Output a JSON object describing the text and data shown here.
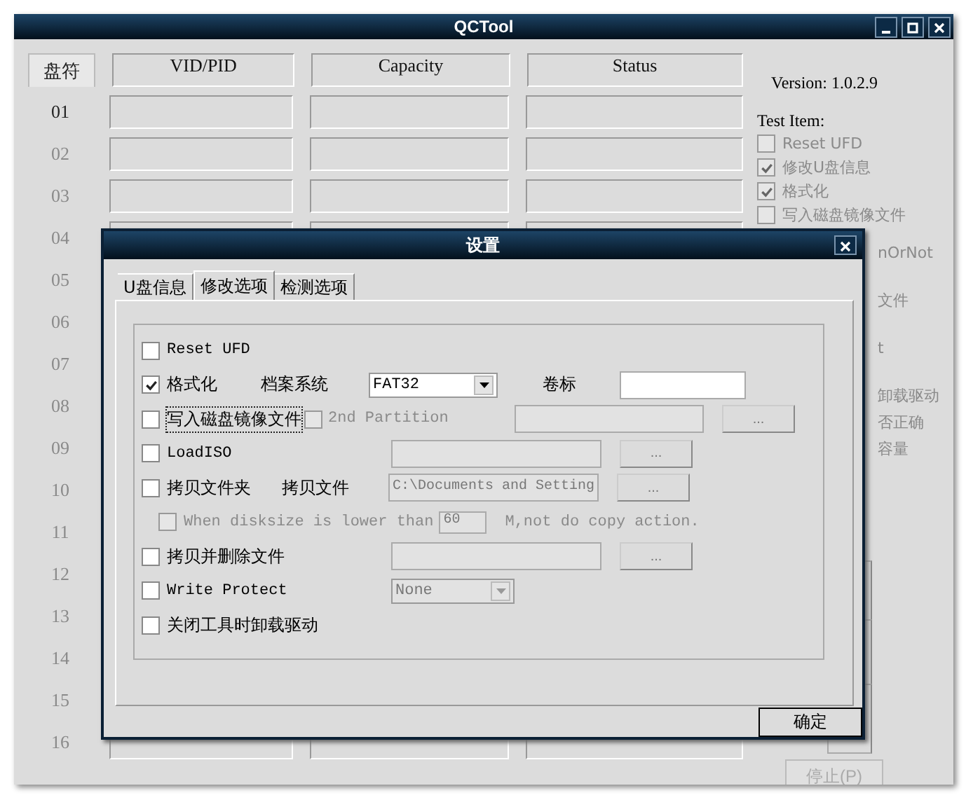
{
  "window": {
    "title": "QCTool"
  },
  "table": {
    "columns": [
      "盘符",
      "VID/PID",
      "Capacity",
      "Status"
    ],
    "rows": [
      {
        "slot": "01",
        "disabled": false
      },
      {
        "slot": "02",
        "disabled": true
      },
      {
        "slot": "03",
        "disabled": true
      },
      {
        "slot": "04",
        "disabled": true
      },
      {
        "slot": "05",
        "disabled": true
      },
      {
        "slot": "06",
        "disabled": true
      },
      {
        "slot": "07",
        "disabled": true
      },
      {
        "slot": "08",
        "disabled": true
      },
      {
        "slot": "09",
        "disabled": true
      },
      {
        "slot": "10",
        "disabled": true
      },
      {
        "slot": "11",
        "disabled": true
      },
      {
        "slot": "12",
        "disabled": true
      },
      {
        "slot": "13",
        "disabled": true
      },
      {
        "slot": "14",
        "disabled": true
      },
      {
        "slot": "15",
        "disabled": true
      },
      {
        "slot": "16",
        "disabled": true
      }
    ]
  },
  "side_panel": {
    "version": "Version: 1.0.2.9",
    "test_item_label": "Test Item:",
    "test_items": [
      {
        "label": "Reset UFD",
        "checked": false
      },
      {
        "label": "修改U盘信息",
        "checked": true
      },
      {
        "label": "格式化",
        "checked": true
      },
      {
        "label": "写入磁盘镜像文件",
        "checked": false
      }
    ],
    "covered_texts": [
      "nOrNot",
      "文件",
      "t",
      "卸载驱动",
      "否正确",
      "容量"
    ],
    "stop_button": "停止(P)"
  },
  "dialog": {
    "title": "设置",
    "tabs": [
      {
        "label": "U盘信息",
        "selected": false
      },
      {
        "label": "修改选项",
        "selected": true
      },
      {
        "label": "检测选项",
        "selected": false
      }
    ],
    "options": [
      {
        "kind": "plain",
        "label": "Reset UFD",
        "checked": false
      },
      {
        "kind": "format",
        "label": "格式化",
        "checked": true,
        "fs_label": "档案系统",
        "fs_value": "FAT32",
        "volume_label": "卷标"
      },
      {
        "kind": "image",
        "label": "写入磁盘镜像文件",
        "checked": false,
        "focused": true,
        "sub_label": "2nd Partition",
        "sub_checked": false,
        "button": "..."
      },
      {
        "kind": "path",
        "label": "LoadISO",
        "checked": false,
        "button": "..."
      },
      {
        "kind": "copy",
        "label": "拷贝文件夹",
        "checked": false,
        "file_label": "拷贝文件",
        "path": "C:\\Documents and Setting",
        "button": "..."
      },
      {
        "kind": "size",
        "label": "When disksize is lower than",
        "checked": false,
        "size": "60",
        "suffix": "M,not do copy action."
      },
      {
        "kind": "path",
        "label": "拷贝并删除文件",
        "checked": false,
        "button": "..."
      },
      {
        "kind": "select",
        "label": "Write Protect",
        "checked": false,
        "value": "None"
      },
      {
        "kind": "plain",
        "label": "关闭工具时卸载驱动",
        "checked": false
      }
    ],
    "ok_button": "确定"
  }
}
